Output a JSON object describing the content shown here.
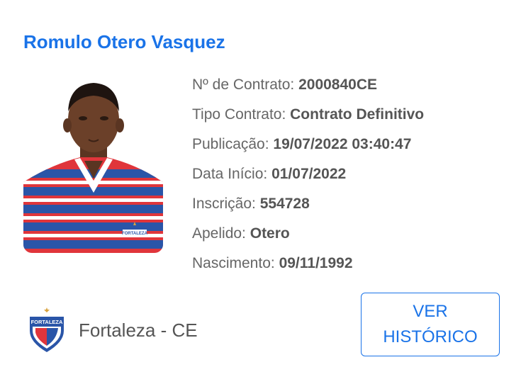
{
  "player": {
    "name": "Romulo Otero Vasquez"
  },
  "details": [
    {
      "label": "Nº de Contrato:",
      "value": "2000840CE"
    },
    {
      "label": "Tipo Contrato:",
      "value": "Contrato Definitivo"
    },
    {
      "label": "Publicação:",
      "value": "19/07/2022 03:40:47"
    },
    {
      "label": "Data Início:",
      "value": "01/07/2022"
    },
    {
      "label": "Inscrição:",
      "value": "554728"
    },
    {
      "label": "Apelido:",
      "value": "Otero"
    },
    {
      "label": "Nascimento:",
      "value": "09/11/1992"
    }
  ],
  "club": {
    "name": "Fortaleza - CE",
    "crest_text": "FORTALEZA"
  },
  "jersey_badge_text": "FORTALEZA",
  "actions": {
    "history_button": "VER HISTÓRICO"
  },
  "colors": {
    "accent": "#1a73e8",
    "label_text": "#666666",
    "value_text": "#555555",
    "jersey_red": "#e0353b",
    "jersey_blue": "#2a55a8"
  },
  "icons": {
    "crest": "fortaleza-crest-icon",
    "photo": "player-photo"
  }
}
